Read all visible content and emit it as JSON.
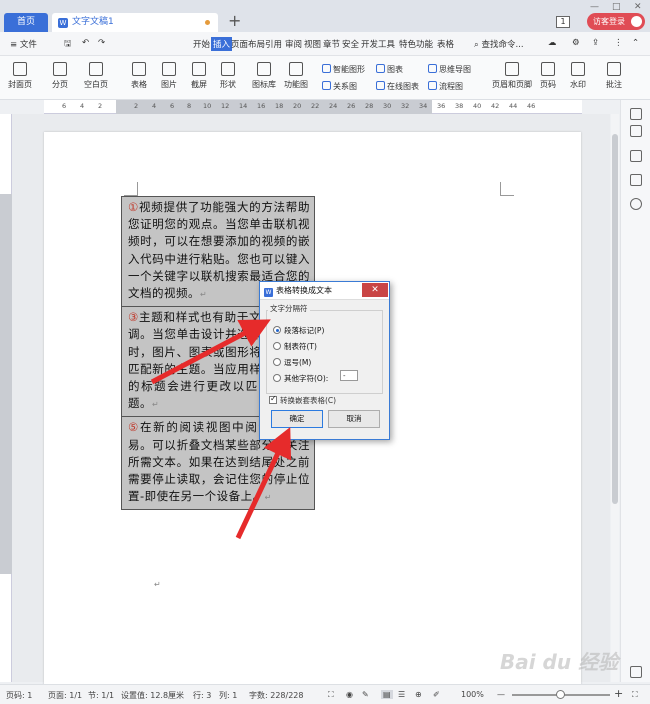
{
  "tabs": {
    "home": "首页",
    "doc": "文字文稿1"
  },
  "window": {
    "badge": "1",
    "visitor": "访客登录"
  },
  "menu": {
    "file": "≡ 文件",
    "items": [
      "开始",
      "插入",
      "页面布局",
      "引用",
      "审阅",
      "视图",
      "章节",
      "安全",
      "开发工具",
      "特色功能",
      "表格"
    ],
    "active": "插入",
    "search": "查找命令..."
  },
  "ribbon": {
    "big": [
      "封面页",
      "分页",
      "空白页",
      "表格",
      "图片",
      "截屏",
      "形状",
      "图标库",
      "功能图",
      "页眉和页脚",
      "页码",
      "水印",
      "批注"
    ],
    "small": [
      "智能图形",
      "图表",
      "思维导图",
      "关系图",
      "在线图表",
      "流程图"
    ]
  },
  "ruler": {
    "ticks": [
      "6",
      "4",
      "2",
      "2",
      "4",
      "6",
      "8",
      "10",
      "12",
      "14",
      "16",
      "18",
      "20",
      "22",
      "24",
      "26",
      "28",
      "30",
      "32",
      "34",
      "36",
      "38",
      "40",
      "42",
      "44",
      "46"
    ]
  },
  "document": {
    "cells": [
      {
        "num": "①",
        "text": "视频提供了功能强大的方法帮助您证明您的观点。当您单击联机视频时，可以在想要添加的视频的嵌入代码中进行粘贴。您也可以键入一个关键字以联机搜索最适合您的文档的视频。"
      },
      {
        "num": "③",
        "text": "主题和样式也有助于文档保持协调。当您单击设计并选择新的主题时，图片、图表或图形将会更改以匹配新的主题。当应用样式时，您的标题会进行更改以匹配新的主题。"
      },
      {
        "num": "⑤",
        "text": "在新的阅读视图中阅读更加容易。可以折叠文档某些部分并关注所需文本。如果在达到结尾处之前需要停止读取，会记住您的停止位置-即使在另一个设备上。"
      }
    ],
    "mark": "↵"
  },
  "dialog": {
    "title": "表格转换成文本",
    "close": "✕",
    "group": "文字分隔符",
    "options": [
      "段落标记(P)",
      "制表符(T)",
      "逗号(M)",
      "其他字符(O):"
    ],
    "selected": 0,
    "other_value": "-",
    "checkbox": "转换嵌套表格(C)",
    "ok": "确定",
    "cancel": "取消"
  },
  "status": {
    "page": "页码: 1",
    "pages": "页面: 1/1",
    "section": "节: 1/1",
    "setting": "设置值: 12.8厘米",
    "row": "行: 3",
    "col": "列: 1",
    "words": "字数: 228/228",
    "zoom": "100%"
  },
  "watermark": "Bai du 经验"
}
